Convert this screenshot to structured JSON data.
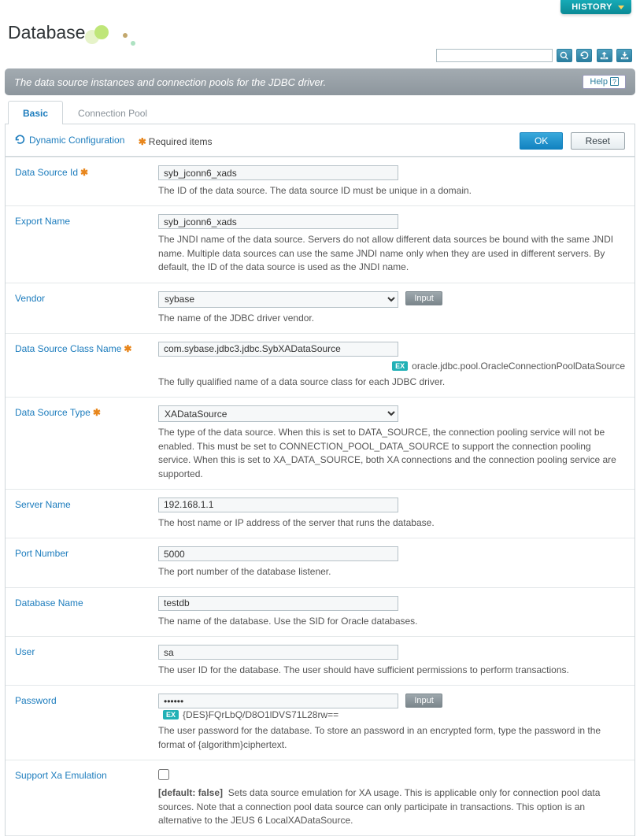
{
  "header": {
    "history_label": "HISTORY",
    "title": "Database"
  },
  "toolbar": {
    "search_button_aria": "Search",
    "refresh_button_aria": "Refresh",
    "export_button_aria": "Export XML",
    "import_button_aria": "Import XML"
  },
  "section": {
    "description": "The data source instances and connection pools for the JDBC driver.",
    "help_label": "Help"
  },
  "tabs": {
    "basic": "Basic",
    "connection_pool": "Connection Pool"
  },
  "legend": {
    "dynamic_conf": "Dynamic Configuration",
    "required_items": "Required items"
  },
  "actions": {
    "ok": "OK",
    "reset": "Reset",
    "input_btn": "Input"
  },
  "fields": {
    "data_source_id": {
      "label": "Data Source Id",
      "value": "syb_jconn6_xads",
      "desc": "The ID of the data source. The data source ID must be unique in a domain."
    },
    "export_name": {
      "label": "Export Name",
      "value": "syb_jconn6_xads",
      "desc": "The JNDI name of the data source. Servers do not allow different data sources be bound with the same JNDI name. Multiple data sources can use the same JNDI name only when they are used in different servers. By default, the ID of the data source is used as the JNDI name."
    },
    "vendor": {
      "label": "Vendor",
      "value": "sybase",
      "desc": "The name of the JDBC driver vendor."
    },
    "ds_class_name": {
      "label": "Data Source Class Name",
      "value": "com.sybase.jdbc3.jdbc.SybXADataSource",
      "example_badge": "EX",
      "example_text": "oracle.jdbc.pool.OracleConnectionPoolDataSource",
      "desc": "The fully qualified name of a data source class for each JDBC driver."
    },
    "ds_type": {
      "label": "Data Source Type",
      "value": "XADataSource",
      "desc": "The type of the data source. When this is set to DATA_SOURCE, the connection pooling service will not be enabled. This must be set to CONNECTION_POOL_DATA_SOURCE to support the connection pooling service. When this is set to XA_DATA_SOURCE, both XA connections and the connection pooling service are supported."
    },
    "server_name": {
      "label": "Server Name",
      "value": "192.168.1.1",
      "desc": "The host name or IP address of the server that runs the database."
    },
    "port_number": {
      "label": "Port Number",
      "value": "5000",
      "desc": "The port number of the database listener."
    },
    "database_name": {
      "label": "Database Name",
      "value": "testdb",
      "desc": "The name of the database. Use the SID for Oracle databases."
    },
    "user": {
      "label": "User",
      "value": "sa",
      "desc": "The user ID for the database. The user should have sufficient permissions to perform transactions."
    },
    "password": {
      "label": "Password",
      "value": "••••••",
      "example_badge": "EX",
      "example_text": "{DES}FQrLbQ/D8O1lDVS71L28rw==",
      "desc": "The user password for the database. To store an password in an encrypted form, type the password in the format of {algorithm}ciphertext."
    },
    "support_xa": {
      "label": "Support Xa Emulation",
      "default_label": "[default: false]",
      "desc_after": "Sets data source emulation for XA usage. This is applicable only for connection pool data sources. Note that a connection pool data source can only participate in transactions. This option is an alternative to the JEUS 6 LocalXADataSource."
    }
  }
}
